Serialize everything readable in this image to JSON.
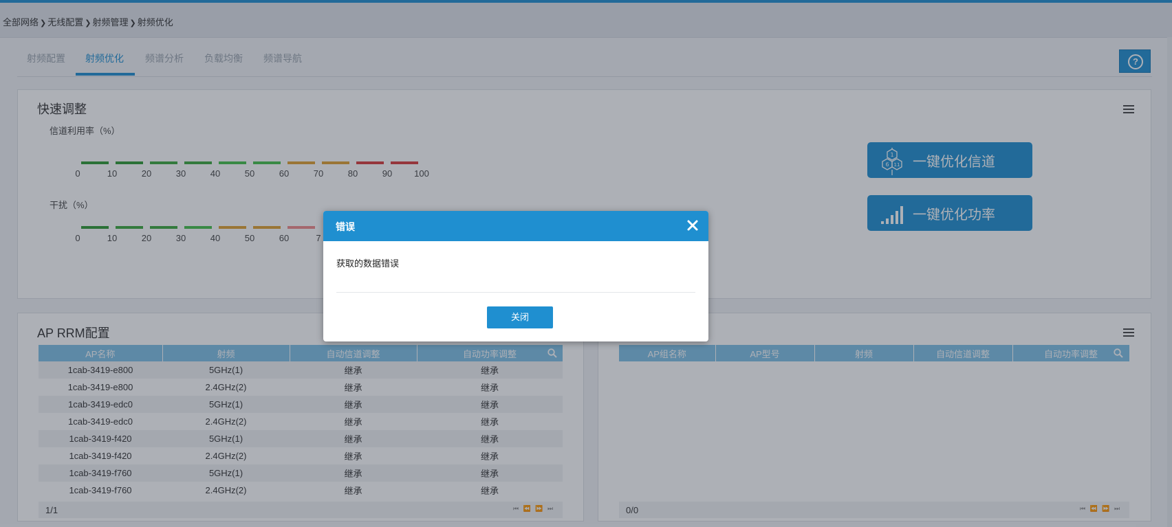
{
  "breadcrumb": [
    "全部网络",
    "无线配置",
    "射频管理",
    "射频优化"
  ],
  "breadcrumb_sep": "❯",
  "tabs": [
    {
      "label": "射频配置",
      "active": false
    },
    {
      "label": "射频优化",
      "active": true
    },
    {
      "label": "频谱分析",
      "active": false
    },
    {
      "label": "负载均衡",
      "active": false
    },
    {
      "label": "频谱导航",
      "active": false
    }
  ],
  "help": {
    "icon": "question-circle-icon",
    "glyph": "?"
  },
  "quick": {
    "title": "快速调整",
    "menu_icon": "list-icon",
    "channel_util": {
      "label": "信道利用率（%）",
      "ticks": [
        "0",
        "10",
        "20",
        "30",
        "40",
        "50",
        "60",
        "70",
        "80",
        "90",
        "100"
      ],
      "segment_colors": [
        "#2e9a32",
        "#2e9a32",
        "#3aa83c",
        "#3aa83c",
        "#44c04a",
        "#44c04a",
        "#e0a030",
        "#e0a030",
        "#d83a3a",
        "#d83a3a"
      ]
    },
    "interference": {
      "label": "干扰（%）",
      "ticks": [
        "0",
        "10",
        "20",
        "30",
        "40",
        "50",
        "60",
        "7"
      ],
      "segment_colors": [
        "#2e9a32",
        "#3aa83c",
        "#3aa83c",
        "#44c04a",
        "#e0a030",
        "#e0a030",
        "#f08a8a"
      ]
    },
    "btn_channel": {
      "label": "一键优化信道",
      "icon": "channel-hex-icon"
    },
    "btn_power": {
      "label": "一键优化功率",
      "icon": "signal-bars-icon"
    }
  },
  "ap_rrm": {
    "title": "AP RRM配置",
    "menu_icon": "list-icon",
    "columns": [
      "AP名称",
      "射频",
      "自动信道调整",
      "自动功率调整"
    ],
    "search_icon": "search-icon",
    "rows": [
      [
        "1cab-3419-e800",
        "5GHz(1)",
        "继承",
        "继承"
      ],
      [
        "1cab-3419-e800",
        "2.4GHz(2)",
        "继承",
        "继承"
      ],
      [
        "1cab-3419-edc0",
        "5GHz(1)",
        "继承",
        "继承"
      ],
      [
        "1cab-3419-edc0",
        "2.4GHz(2)",
        "继承",
        "继承"
      ],
      [
        "1cab-3419-f420",
        "5GHz(1)",
        "继承",
        "继承"
      ],
      [
        "1cab-3419-f420",
        "2.4GHz(2)",
        "继承",
        "继承"
      ],
      [
        "1cab-3419-f760",
        "5GHz(1)",
        "继承",
        "继承"
      ],
      [
        "1cab-3419-f760",
        "2.4GHz(2)",
        "继承",
        "继承"
      ]
    ],
    "pager": {
      "count": "1/1",
      "nav": "⏮ ⏪ ⏩ ⏭"
    }
  },
  "ap_group": {
    "menu_icon": "list-icon",
    "columns": [
      "AP组名称",
      "AP型号",
      "射频",
      "自动信道调整",
      "自动功率调整"
    ],
    "search_icon": "search-icon",
    "rows": [],
    "pager": {
      "count": "0/0",
      "nav": "⏮ ⏪ ⏩ ⏭"
    }
  },
  "dialog": {
    "title": "错误",
    "message": "获取的数据错误",
    "close_label": "关闭",
    "close_icon": "close-icon"
  },
  "colors": {
    "accent": "#1f8fd0",
    "header": "#7fc0e6"
  }
}
